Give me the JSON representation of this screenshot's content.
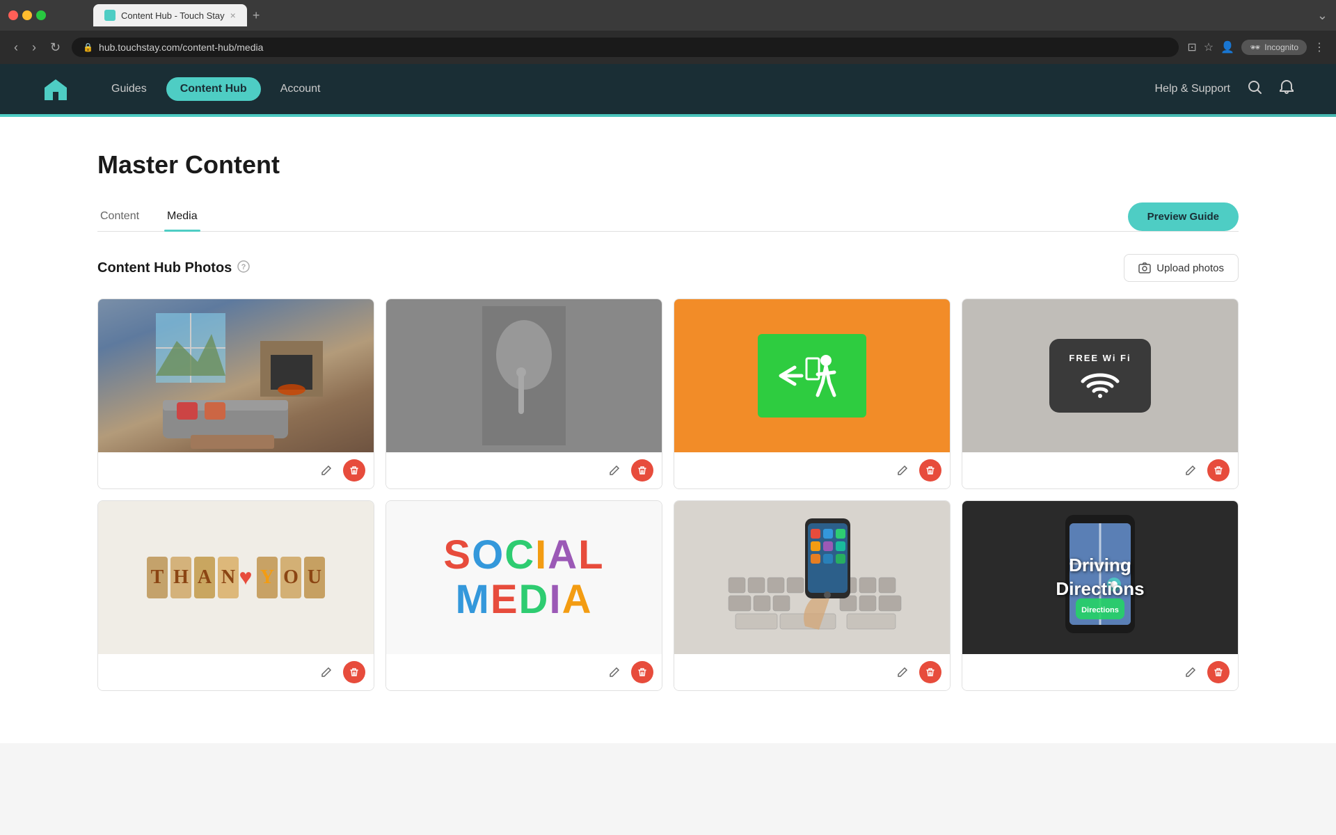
{
  "browser": {
    "tab_title": "Content Hub - Touch Stay",
    "url": "hub.touchstay.com/content-hub/media",
    "tab_close": "×",
    "tab_new": "+",
    "nav_back": "‹",
    "nav_forward": "›",
    "nav_reload": "↻",
    "incognito_label": "Incognito",
    "browser_menu": "⋮",
    "collapse_icon": "⌄"
  },
  "navbar": {
    "logo_alt": "Home icon",
    "guides_label": "Guides",
    "content_hub_label": "Content Hub",
    "account_label": "Account",
    "help_label": "Help & Support",
    "search_icon": "🔍",
    "bell_icon": "🔔"
  },
  "page": {
    "title": "Master Content",
    "tabs": [
      {
        "label": "Content",
        "active": false
      },
      {
        "label": "Media",
        "active": true
      }
    ],
    "preview_button": "Preview Guide"
  },
  "photos_section": {
    "title": "Content Hub Photos",
    "help_icon": "?",
    "upload_button": "Upload photos",
    "camera_icon": "📷"
  },
  "photos": [
    {
      "id": 1,
      "type": "living-room",
      "alt": "Living room interior"
    },
    {
      "id": 2,
      "type": "silence",
      "alt": "Silence gesture"
    },
    {
      "id": 3,
      "type": "exit",
      "alt": "Exit sign"
    },
    {
      "id": 4,
      "type": "wifi",
      "alt": "Free WiFi sign"
    },
    {
      "id": 5,
      "type": "thankyou",
      "alt": "Thank you letters"
    },
    {
      "id": 6,
      "type": "social",
      "alt": "Social Media text"
    },
    {
      "id": 7,
      "type": "phone",
      "alt": "Phone on keyboard"
    },
    {
      "id": 8,
      "type": "directions",
      "alt": "Driving Directions"
    }
  ],
  "actions": {
    "edit_icon": "✏",
    "delete_icon": "🗑"
  },
  "directions_text": "Driving\nDirections"
}
